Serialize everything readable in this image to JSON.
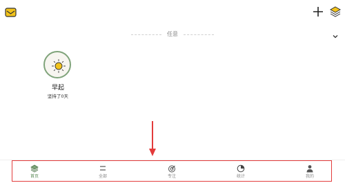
{
  "section": {
    "title": "任意"
  },
  "habits": [
    {
      "name": "早起",
      "streak": "坚持了0天",
      "icon": "sun-icon"
    }
  ],
  "bottom_nav": {
    "items": [
      {
        "label": "首页",
        "icon": "home-stack-icon",
        "active": true
      },
      {
        "label": "全部",
        "icon": "list-icon",
        "active": false
      },
      {
        "label": "专注",
        "icon": "target-icon",
        "active": false
      },
      {
        "label": "统计",
        "icon": "pie-chart-icon",
        "active": false
      },
      {
        "label": "我的",
        "icon": "user-icon",
        "active": false
      }
    ]
  },
  "colors": {
    "accent": "#f2c31b",
    "active_green": "#5a8a57",
    "annotation_red": "#e33b3b"
  }
}
